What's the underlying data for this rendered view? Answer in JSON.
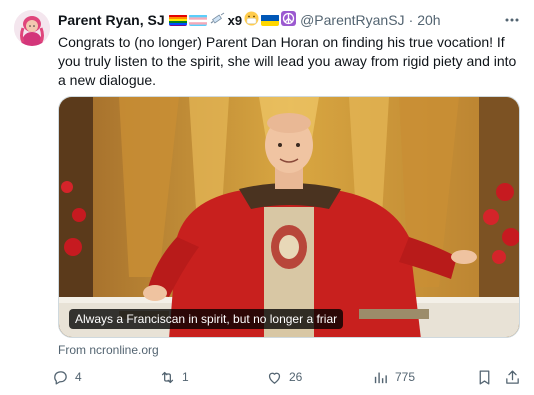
{
  "author": {
    "name": "Parent Ryan, SJ",
    "emoji_suffix": "x9",
    "handle": "@ParentRyanSJ",
    "separator": "·",
    "timestamp": "20h"
  },
  "tweet": {
    "text": "Congrats to (no longer) Parent Dan Horan on finding his true vocation! If you truly listen to the spirit, she will lead you away from rigid piety and into a new dialogue."
  },
  "media": {
    "caption": "Always a Franciscan in spirit, but no longer a friar",
    "source": "From ncronline.org"
  },
  "actions": {
    "replies": "4",
    "retweets": "1",
    "likes": "26",
    "views": "775"
  },
  "icons": {
    "header": [
      "rainbow-flag-icon",
      "trans-flag-icon",
      "syringe-icon",
      "mask-face-icon",
      "ukraine-flag-icon",
      "peace-sign-icon"
    ],
    "actions": [
      "reply-icon",
      "retweet-icon",
      "like-icon",
      "views-icon",
      "bookmark-icon",
      "share-icon"
    ],
    "more": "more-icon"
  },
  "colors": {
    "text": "#0f1419",
    "muted": "#536471",
    "border": "#cfd9de",
    "vestment_red": "#c8201e"
  }
}
